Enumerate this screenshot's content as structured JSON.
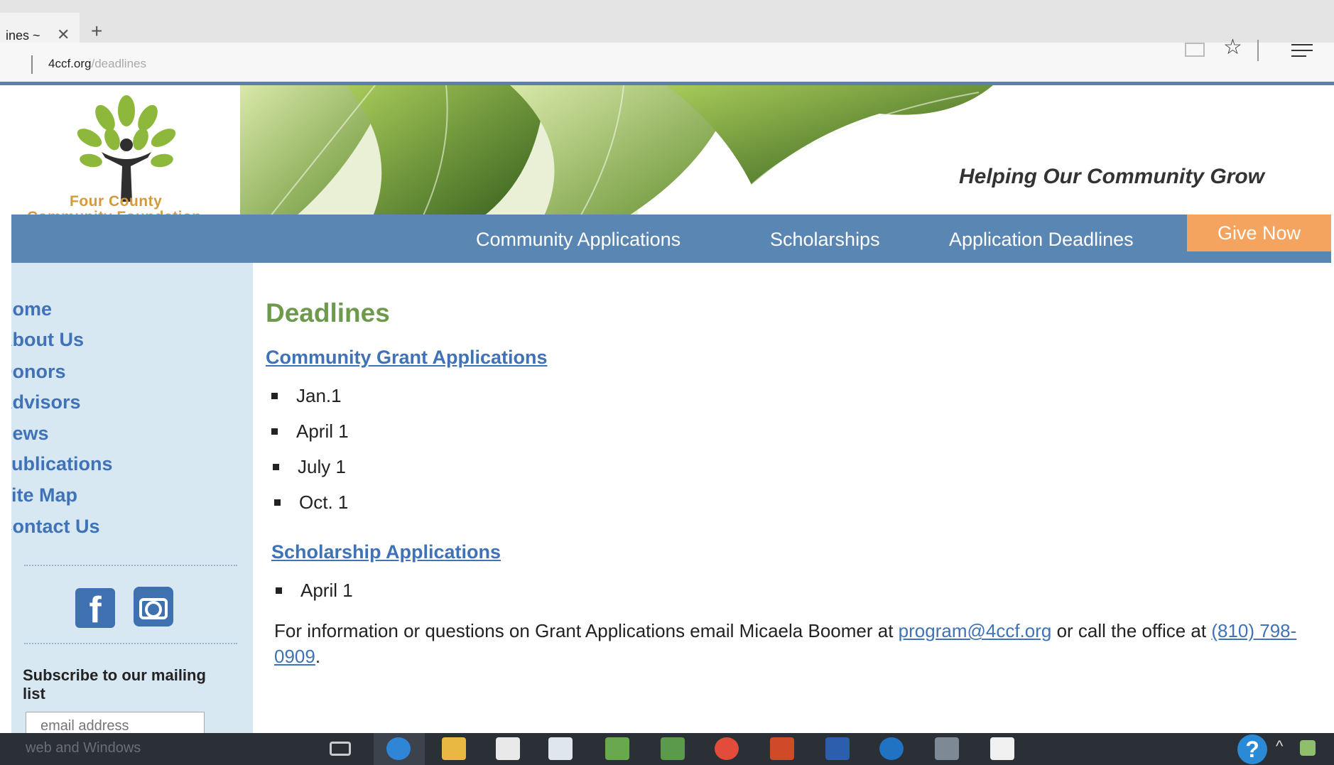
{
  "browser": {
    "tab_title": "ines ~",
    "close_glyph": "✕",
    "new_tab_glyph": "+",
    "url_host": "4ccf.org",
    "url_path": "/deadlines",
    "star_glyph": "☆"
  },
  "header": {
    "logo_line1": "Four   County",
    "logo_line2": "Community Foundation",
    "tagline": "Helping Our Community Grow"
  },
  "nav": {
    "items": [
      "Community Applications",
      "Scholarships",
      "Application Deadlines"
    ],
    "give_now": "Give Now"
  },
  "sidebar": {
    "links": [
      "Home",
      "About Us",
      "Donors",
      "Advisors",
      "News",
      "Publications",
      "Site Map",
      "Contact Us"
    ],
    "facebook_glyph": "f",
    "subscribe_label": "Subscribe to our mailing list",
    "email_placeholder": "email address"
  },
  "main": {
    "title": "Deadlines",
    "grant_heading": "Community Grant Applications",
    "grant_dates": [
      "Jan.1",
      "April 1",
      "July 1",
      "Oct. 1"
    ],
    "scholarship_heading": "Scholarship Applications",
    "scholarship_dates": [
      "April 1"
    ],
    "info_prefix": "For information or questions on Grant Applications email Micaela Boomer at ",
    "info_email": "program@4ccf.org",
    "info_middle": " or call the office at ",
    "info_phone": "(810) 798-0909",
    "info_suffix": "."
  },
  "taskbar": {
    "search_hint": "web and Windows",
    "help_glyph": "?",
    "chevron_glyph": "^"
  },
  "colors": {
    "nav_blue": "#5a86b4",
    "give_now_orange": "#f4a45e",
    "link_blue": "#3f72b6",
    "title_green": "#6e9a4c",
    "sidebar_bg": "#d8e8f2"
  }
}
